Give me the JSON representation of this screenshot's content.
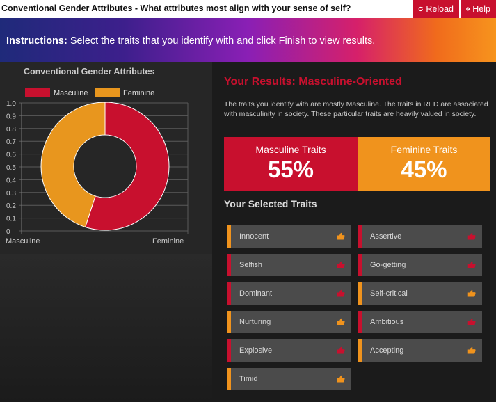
{
  "title_bar": {
    "title": "Conventional Gender Attributes - What attributes most align with your sense of self?",
    "reload_label": "Reload",
    "help_label": "Help"
  },
  "banner": {
    "instructions_label": "Instructions:",
    "instructions_text": " Select the traits that you identify with and click Finish to view results."
  },
  "chart": {
    "title": "Conventional Gender Attributes",
    "legend": [
      {
        "name": "Masculine",
        "color": "#c8102e"
      },
      {
        "name": "Feminine",
        "color": "#e8961e"
      }
    ]
  },
  "chart_data": {
    "type": "pie",
    "title": "Conventional Gender Attributes",
    "donut": true,
    "categories": [
      "Masculine",
      "Feminine"
    ],
    "values": [
      55,
      45
    ],
    "colors": [
      "#c8102e",
      "#e8961e"
    ],
    "y_ticks": [
      "1.0",
      "0.9",
      "0.8",
      "0.7",
      "0.6",
      "0.5",
      "0.4",
      "0.3",
      "0.2",
      "0.1",
      "0"
    ],
    "x_ticks": [
      "Masculine",
      "Feminine"
    ],
    "legend_position": "top",
    "grid": true
  },
  "results": {
    "heading": "Your Results: Masculine-Oriented",
    "description": "The traits you identify with are mostly Masculine. The traits in RED are associated with masculinity in society. These particular traits are heavily valued in society.",
    "masculine_label": "Masculine Traits",
    "masculine_value": "55%",
    "feminine_label": "Feminine Traits",
    "feminine_value": "45%",
    "selected_heading": "Your Selected Traits"
  },
  "traits": [
    {
      "name": "Innocent",
      "type": "fem"
    },
    {
      "name": "Assertive",
      "type": "masc"
    },
    {
      "name": "Selfish",
      "type": "masc"
    },
    {
      "name": "Go-getting",
      "type": "masc"
    },
    {
      "name": "Dominant",
      "type": "masc"
    },
    {
      "name": "Self-critical",
      "type": "fem"
    },
    {
      "name": "Nurturing",
      "type": "fem"
    },
    {
      "name": "Ambitious",
      "type": "masc"
    },
    {
      "name": "Explosive",
      "type": "masc"
    },
    {
      "name": "Accepting",
      "type": "fem"
    },
    {
      "name": "Timid",
      "type": "fem"
    }
  ],
  "colors": {
    "masculine": "#c8102e",
    "feminine": "#f0931d"
  },
  "icons": {
    "thumb": "thumbs-up-icon",
    "reload": "refresh-icon",
    "help": "question-circle-icon"
  }
}
